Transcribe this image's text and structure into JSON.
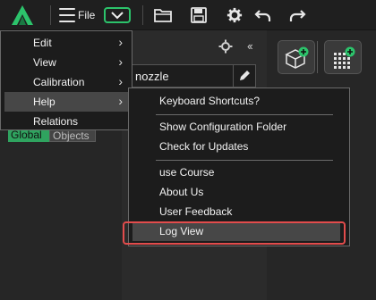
{
  "toolbar": {
    "file_label": "File",
    "icons": [
      "app-logo-icon",
      "hamburger-icon",
      "chevron-down-icon",
      "folder-icon",
      "save-icon",
      "gear-icon",
      "undo-icon",
      "redo-icon"
    ],
    "accent_color": "#2cc36b"
  },
  "panel": {
    "search_value": "nozzle",
    "segments": [
      "Global",
      "Objects"
    ],
    "collapse_label": "‹‹"
  },
  "viewport_buttons": [
    "add-cube-icon",
    "add-grid-icon"
  ],
  "main_menu": {
    "items": [
      {
        "label": "Edit",
        "arrow": "›"
      },
      {
        "label": "View",
        "arrow": "›"
      },
      {
        "label": "Calibration",
        "arrow": "›"
      },
      {
        "label": "Help",
        "arrow": "›"
      },
      {
        "label": "Relations",
        "arrow": ""
      }
    ],
    "active": "Help"
  },
  "help_menu": {
    "items": [
      "Keyboard Shortcuts?",
      "Show Configuration Folder",
      "Check for Updates",
      "use Course",
      "About Us",
      "User Feedback",
      "Log View"
    ],
    "active": "Log View",
    "highlight_color": "#e24c4c"
  }
}
